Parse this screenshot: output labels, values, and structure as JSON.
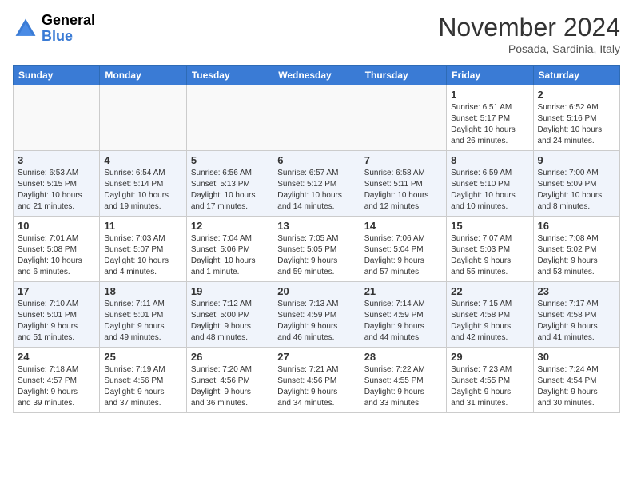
{
  "header": {
    "logo_general": "General",
    "logo_blue": "Blue",
    "month_title": "November 2024",
    "location": "Posada, Sardinia, Italy"
  },
  "weekdays": [
    "Sunday",
    "Monday",
    "Tuesday",
    "Wednesday",
    "Thursday",
    "Friday",
    "Saturday"
  ],
  "weeks": [
    [
      {
        "day": "",
        "info": ""
      },
      {
        "day": "",
        "info": ""
      },
      {
        "day": "",
        "info": ""
      },
      {
        "day": "",
        "info": ""
      },
      {
        "day": "",
        "info": ""
      },
      {
        "day": "1",
        "info": "Sunrise: 6:51 AM\nSunset: 5:17 PM\nDaylight: 10 hours\nand 26 minutes."
      },
      {
        "day": "2",
        "info": "Sunrise: 6:52 AM\nSunset: 5:16 PM\nDaylight: 10 hours\nand 24 minutes."
      }
    ],
    [
      {
        "day": "3",
        "info": "Sunrise: 6:53 AM\nSunset: 5:15 PM\nDaylight: 10 hours\nand 21 minutes."
      },
      {
        "day": "4",
        "info": "Sunrise: 6:54 AM\nSunset: 5:14 PM\nDaylight: 10 hours\nand 19 minutes."
      },
      {
        "day": "5",
        "info": "Sunrise: 6:56 AM\nSunset: 5:13 PM\nDaylight: 10 hours\nand 17 minutes."
      },
      {
        "day": "6",
        "info": "Sunrise: 6:57 AM\nSunset: 5:12 PM\nDaylight: 10 hours\nand 14 minutes."
      },
      {
        "day": "7",
        "info": "Sunrise: 6:58 AM\nSunset: 5:11 PM\nDaylight: 10 hours\nand 12 minutes."
      },
      {
        "day": "8",
        "info": "Sunrise: 6:59 AM\nSunset: 5:10 PM\nDaylight: 10 hours\nand 10 minutes."
      },
      {
        "day": "9",
        "info": "Sunrise: 7:00 AM\nSunset: 5:09 PM\nDaylight: 10 hours\nand 8 minutes."
      }
    ],
    [
      {
        "day": "10",
        "info": "Sunrise: 7:01 AM\nSunset: 5:08 PM\nDaylight: 10 hours\nand 6 minutes."
      },
      {
        "day": "11",
        "info": "Sunrise: 7:03 AM\nSunset: 5:07 PM\nDaylight: 10 hours\nand 4 minutes."
      },
      {
        "day": "12",
        "info": "Sunrise: 7:04 AM\nSunset: 5:06 PM\nDaylight: 10 hours\nand 1 minute."
      },
      {
        "day": "13",
        "info": "Sunrise: 7:05 AM\nSunset: 5:05 PM\nDaylight: 9 hours\nand 59 minutes."
      },
      {
        "day": "14",
        "info": "Sunrise: 7:06 AM\nSunset: 5:04 PM\nDaylight: 9 hours\nand 57 minutes."
      },
      {
        "day": "15",
        "info": "Sunrise: 7:07 AM\nSunset: 5:03 PM\nDaylight: 9 hours\nand 55 minutes."
      },
      {
        "day": "16",
        "info": "Sunrise: 7:08 AM\nSunset: 5:02 PM\nDaylight: 9 hours\nand 53 minutes."
      }
    ],
    [
      {
        "day": "17",
        "info": "Sunrise: 7:10 AM\nSunset: 5:01 PM\nDaylight: 9 hours\nand 51 minutes."
      },
      {
        "day": "18",
        "info": "Sunrise: 7:11 AM\nSunset: 5:01 PM\nDaylight: 9 hours\nand 49 minutes."
      },
      {
        "day": "19",
        "info": "Sunrise: 7:12 AM\nSunset: 5:00 PM\nDaylight: 9 hours\nand 48 minutes."
      },
      {
        "day": "20",
        "info": "Sunrise: 7:13 AM\nSunset: 4:59 PM\nDaylight: 9 hours\nand 46 minutes."
      },
      {
        "day": "21",
        "info": "Sunrise: 7:14 AM\nSunset: 4:59 PM\nDaylight: 9 hours\nand 44 minutes."
      },
      {
        "day": "22",
        "info": "Sunrise: 7:15 AM\nSunset: 4:58 PM\nDaylight: 9 hours\nand 42 minutes."
      },
      {
        "day": "23",
        "info": "Sunrise: 7:17 AM\nSunset: 4:58 PM\nDaylight: 9 hours\nand 41 minutes."
      }
    ],
    [
      {
        "day": "24",
        "info": "Sunrise: 7:18 AM\nSunset: 4:57 PM\nDaylight: 9 hours\nand 39 minutes."
      },
      {
        "day": "25",
        "info": "Sunrise: 7:19 AM\nSunset: 4:56 PM\nDaylight: 9 hours\nand 37 minutes."
      },
      {
        "day": "26",
        "info": "Sunrise: 7:20 AM\nSunset: 4:56 PM\nDaylight: 9 hours\nand 36 minutes."
      },
      {
        "day": "27",
        "info": "Sunrise: 7:21 AM\nSunset: 4:56 PM\nDaylight: 9 hours\nand 34 minutes."
      },
      {
        "day": "28",
        "info": "Sunrise: 7:22 AM\nSunset: 4:55 PM\nDaylight: 9 hours\nand 33 minutes."
      },
      {
        "day": "29",
        "info": "Sunrise: 7:23 AM\nSunset: 4:55 PM\nDaylight: 9 hours\nand 31 minutes."
      },
      {
        "day": "30",
        "info": "Sunrise: 7:24 AM\nSunset: 4:54 PM\nDaylight: 9 hours\nand 30 minutes."
      }
    ]
  ]
}
